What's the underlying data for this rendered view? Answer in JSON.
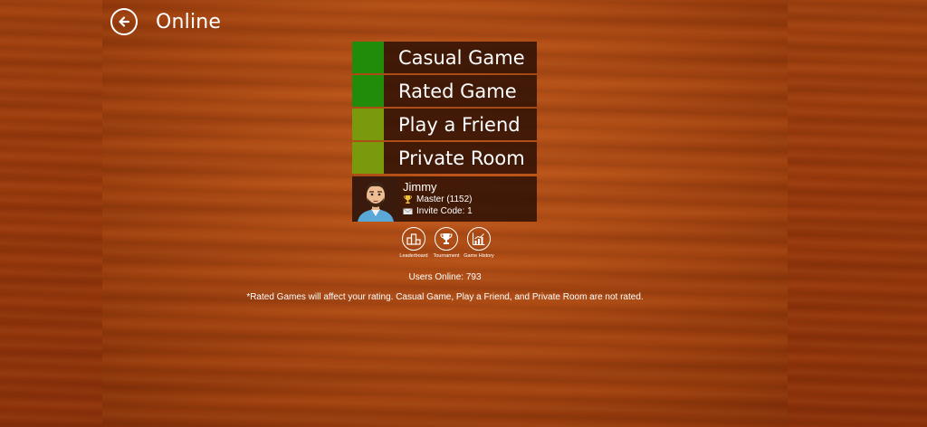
{
  "header": {
    "title": "Online",
    "back_icon": "back-arrow-icon"
  },
  "menu": {
    "items": [
      {
        "label": "Casual Game",
        "color": "#218c0a"
      },
      {
        "label": "Rated Game",
        "color": "#218c0a"
      },
      {
        "label": "Play a Friend",
        "color": "#7a9a0e"
      },
      {
        "label": "Private Room",
        "color": "#7a9a0e"
      }
    ]
  },
  "profile": {
    "name": "Jimmy",
    "rank": "Master (1152)",
    "invite": "Invite Code: 1",
    "rank_icon": "trophy-icon",
    "invite_icon": "envelope-icon"
  },
  "actions": [
    {
      "label": "Leaderboard",
      "icon": "podium-icon"
    },
    {
      "label": "Tournament",
      "icon": "trophy-icon"
    },
    {
      "label": "Game History",
      "icon": "chart-icon"
    }
  ],
  "status": {
    "users_online": "Users Online: 793",
    "note": "*Rated Games will affect your rating. Casual Game, Play a Friend, and Private Room are not rated."
  },
  "colors": {
    "wood": "#a2420f",
    "panel": "#b04c14",
    "menu_bg": "#28100a",
    "green": "#218c0a",
    "olive": "#7a9a0e"
  }
}
